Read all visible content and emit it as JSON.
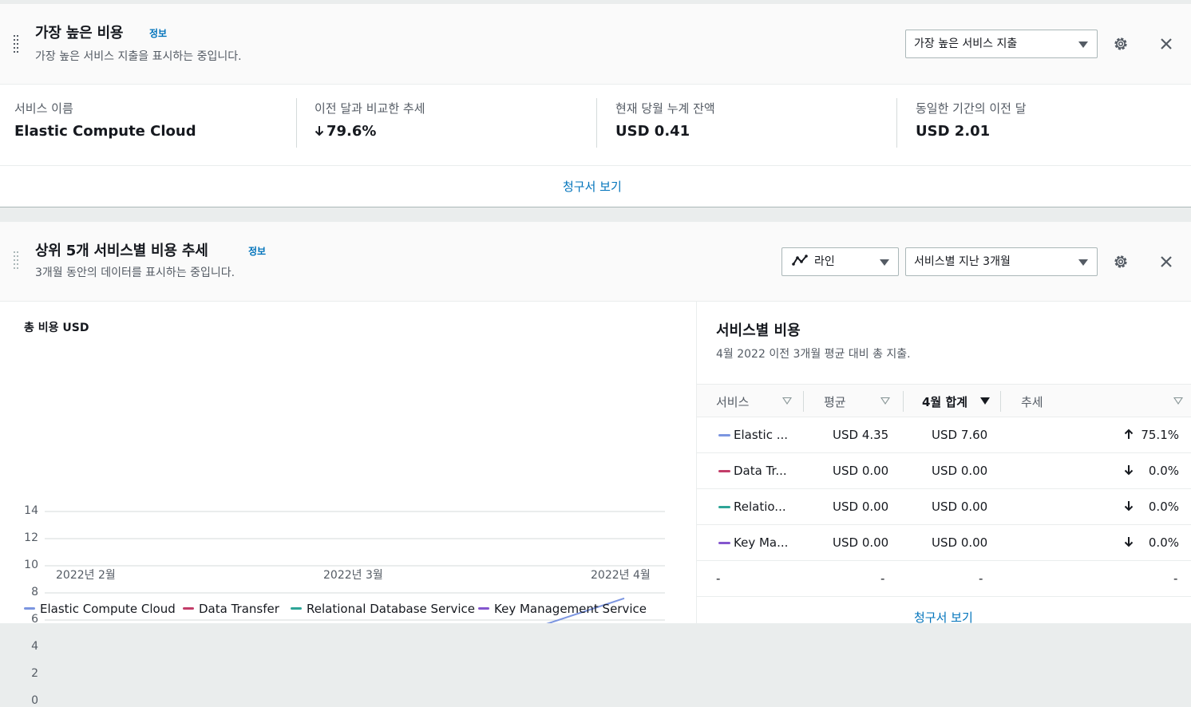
{
  "panel1": {
    "title": "가장 높은 비용",
    "info": "정보",
    "subtitle": "가장 높은 서비스 지출을 표시하는 중입니다.",
    "select": "가장 높은 서비스 지출",
    "stats": [
      {
        "label": "서비스 이름",
        "value": "Elastic Compute Cloud"
      },
      {
        "label": "이전 달과 비교한 추세",
        "value": "79.6%"
      },
      {
        "label": "현재 당월 누계 잔액",
        "value": "USD 0.41"
      },
      {
        "label": "동일한 기간의 이전 달",
        "value": "USD 2.01"
      }
    ],
    "link": "청구서 보기"
  },
  "panel2": {
    "title": "상위 5개 서비스별 비용 추세",
    "info": "정보",
    "subtitle": "3개월 동안의 데이터를 표시하는 중입니다.",
    "chart_type_select": "라인",
    "period_select": "서비스별 지난 3개월",
    "side": {
      "title": "서비스별 비용",
      "subtitle": "4월 2022 이전 3개월 평균 대비 총 지출.",
      "headers": [
        "서비스",
        "평균",
        "4월 합계",
        "추세"
      ],
      "rows": [
        {
          "service": "Elastic ...",
          "avg": "USD 4.35",
          "total": "USD 7.60",
          "trend": "75.1%",
          "dir": "up",
          "color": "#7b95e0"
        },
        {
          "service": "Data Tr...",
          "avg": "USD 0.00",
          "total": "USD 0.00",
          "trend": "0.0%",
          "dir": "down",
          "color": "#c33d69"
        },
        {
          "service": "Relatio...",
          "avg": "USD 0.00",
          "total": "USD 0.00",
          "trend": "0.0%",
          "dir": "down",
          "color": "#2ea597"
        },
        {
          "service": "Key Ma...",
          "avg": "USD 0.00",
          "total": "USD 0.00",
          "trend": "0.0%",
          "dir": "down",
          "color": "#8456ce"
        }
      ],
      "empty_row": [
        "-",
        "-",
        "-",
        "-"
      ],
      "link": "청구서 보기"
    }
  },
  "chart_data": {
    "type": "line",
    "title": "총 비용 USD",
    "x": [
      "2022년 2월",
      "2022년 3월",
      "2022년 4월"
    ],
    "ylim": [
      0,
      14
    ],
    "yticks": [
      0,
      2,
      4,
      6,
      8,
      10,
      12,
      14
    ],
    "grid": true,
    "legend_position": "bottom",
    "series": [
      {
        "name": "Elastic Compute Cloud",
        "color": "#7b95e0",
        "values": [
          null,
          1.1,
          7.6
        ]
      },
      {
        "name": "Data Transfer",
        "color": "#c33d69",
        "values": [
          null,
          0.0,
          0.0
        ]
      },
      {
        "name": "Relational Database Service",
        "color": "#2ea597",
        "values": [
          null,
          0.0,
          0.0
        ]
      },
      {
        "name": "Key Management Service",
        "color": "#8456ce",
        "values": [
          null,
          0.0,
          0.0
        ]
      }
    ]
  }
}
